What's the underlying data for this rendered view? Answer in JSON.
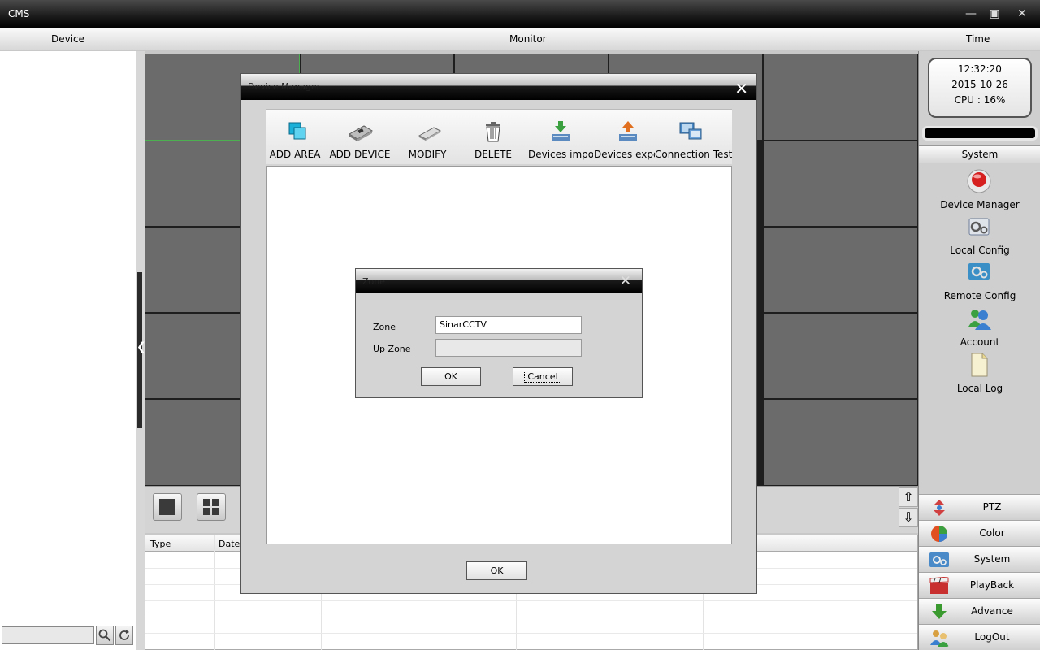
{
  "app": {
    "title": "CMS"
  },
  "window_controls": {
    "minimize": "—",
    "maximize": "▣",
    "close": "✕"
  },
  "menu": {
    "device": "Device",
    "monitor": "Monitor",
    "time": "Time"
  },
  "left_panel": {
    "search_placeholder": "",
    "search_icon": "magnifier-icon",
    "refresh_icon": "refresh-icon"
  },
  "status": {
    "time": "12:32:20",
    "date": "2015-10-26",
    "cpu": "CPU : 16%"
  },
  "system_panel": {
    "header": "System",
    "items": [
      {
        "label": "Device Manager",
        "icon": "device-manager-icon",
        "color": "#d62020"
      },
      {
        "label": "Local Config",
        "icon": "local-config-icon",
        "color": "#6f7f9a"
      },
      {
        "label": "Remote Config",
        "icon": "remote-config-icon",
        "color": "#3a8fc6"
      },
      {
        "label": "Account",
        "icon": "account-icon",
        "color": "#3a7fd0"
      },
      {
        "label": "Local Log",
        "icon": "local-log-icon",
        "color": "#e8d890"
      }
    ]
  },
  "nav_buttons": [
    {
      "label": "PTZ",
      "icon": "ptz-icon",
      "color": "#d04040"
    },
    {
      "label": "Color",
      "icon": "color-icon",
      "color": "#e05020"
    },
    {
      "label": "System",
      "icon": "system-icon",
      "color": "#4a8ac8"
    },
    {
      "label": "PlayBack",
      "icon": "playback-icon",
      "color": "#c83030"
    },
    {
      "label": "Advance",
      "icon": "advance-icon",
      "color": "#3a9a30"
    },
    {
      "label": "LogOut",
      "icon": "logout-icon",
      "color": "#d8a040"
    }
  ],
  "log_table": {
    "columns": [
      "Type",
      "Date"
    ]
  },
  "device_manager": {
    "title": "Device Manager",
    "toolbar": [
      {
        "label": "ADD AREA",
        "icon": "add-area-icon",
        "color": "#1ab0d8"
      },
      {
        "label": "ADD DEVICE",
        "icon": "add-device-icon",
        "color": "#888888"
      },
      {
        "label": "MODIFY",
        "icon": "modify-icon",
        "color": "#999999"
      },
      {
        "label": "DELETE",
        "icon": "delete-icon",
        "color": "#555555"
      },
      {
        "label": "Devices import",
        "icon": "devices-import-icon",
        "color": "#3aa040"
      },
      {
        "label": "Devices expor",
        "icon": "devices-export-icon",
        "color": "#e07020"
      },
      {
        "label": "Connection  Test",
        "icon": "connection-test-icon",
        "color": "#4a8ac8"
      }
    ],
    "ok_label": "OK"
  },
  "zone_dialog": {
    "title": "Zone",
    "zone_label": "Zone",
    "zone_value": "SinarCCTV",
    "up_zone_label": "Up Zone",
    "up_zone_value": "",
    "ok_label": "OK",
    "cancel_label": "Cancel"
  }
}
